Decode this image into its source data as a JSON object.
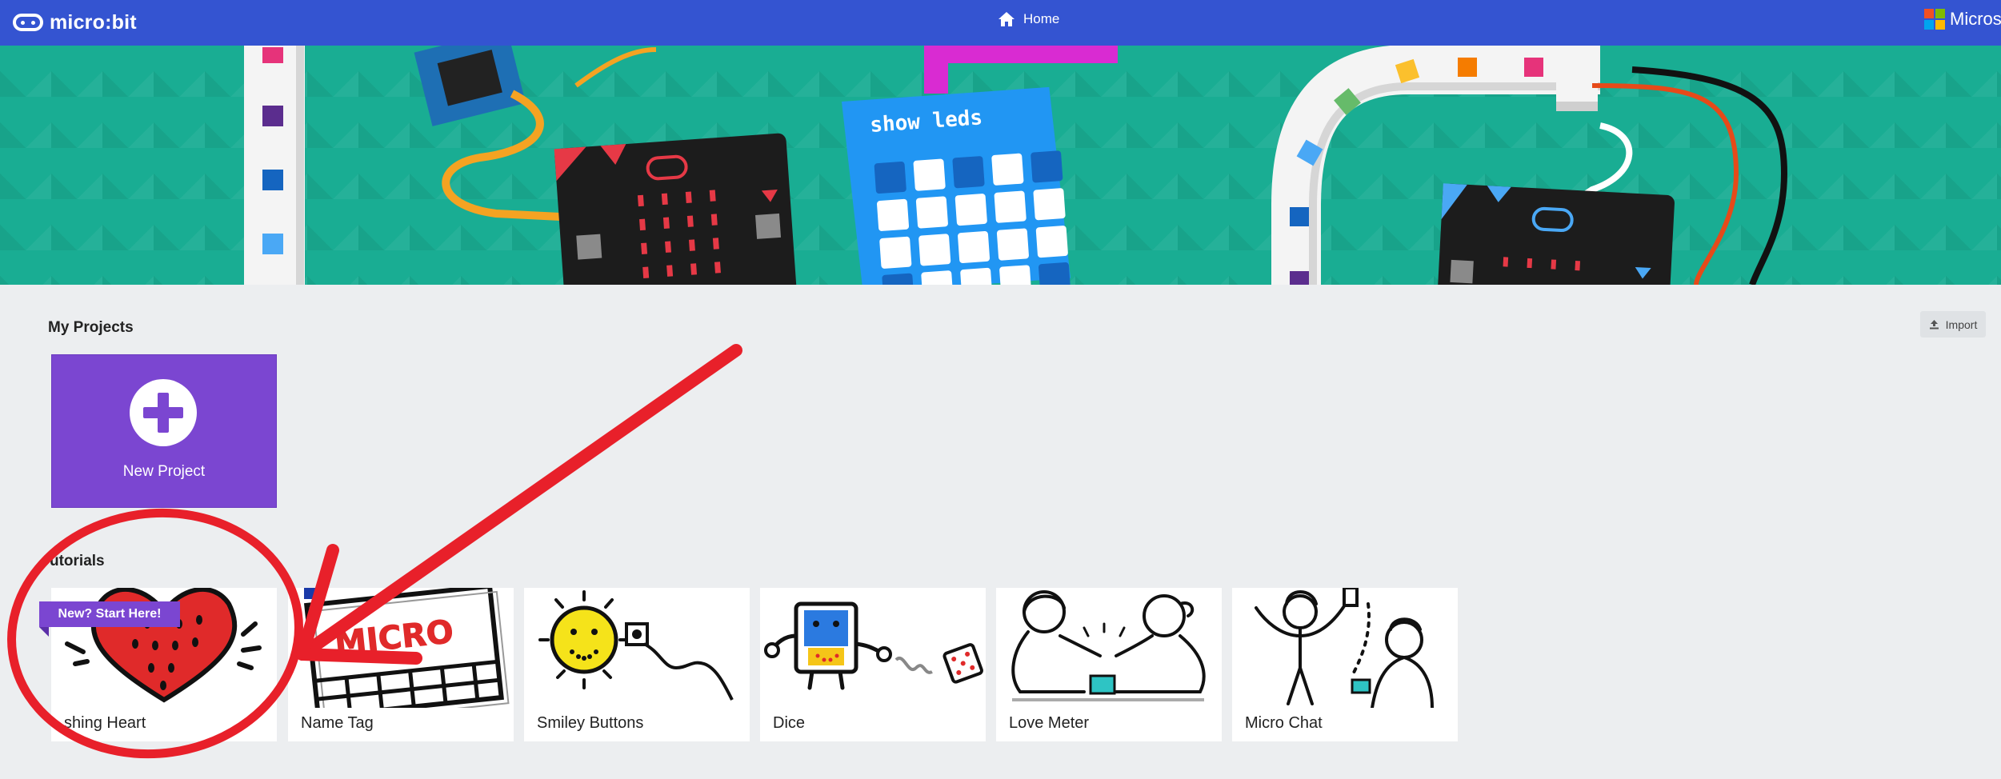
{
  "header": {
    "logo_text": "micro:bit",
    "home_label": "Home",
    "brand_label": "Micros",
    "home_icon": "home-icon",
    "logo_icon": "microbit-logo-icon",
    "brand_icon": "microsoft-logo-icon"
  },
  "hero": {
    "code_block_label": "show leds"
  },
  "my_projects": {
    "title": "My Projects",
    "import_label": "Import",
    "import_icon": "upload-icon",
    "new_project_label": "New Project"
  },
  "tutorials": {
    "title": "utorials",
    "badge": "New? Start Here!",
    "items": [
      {
        "label": "shing Heart"
      },
      {
        "label": "Name Tag"
      },
      {
        "label": "Smiley Buttons"
      },
      {
        "label": "Dice"
      },
      {
        "label": "Love Meter"
      },
      {
        "label": "Micro Chat"
      }
    ]
  },
  "colors": {
    "header": "#3454d1",
    "hero": "#19ad93",
    "accent_purple": "#7b46d1",
    "annotation_red": "#e8202a"
  }
}
